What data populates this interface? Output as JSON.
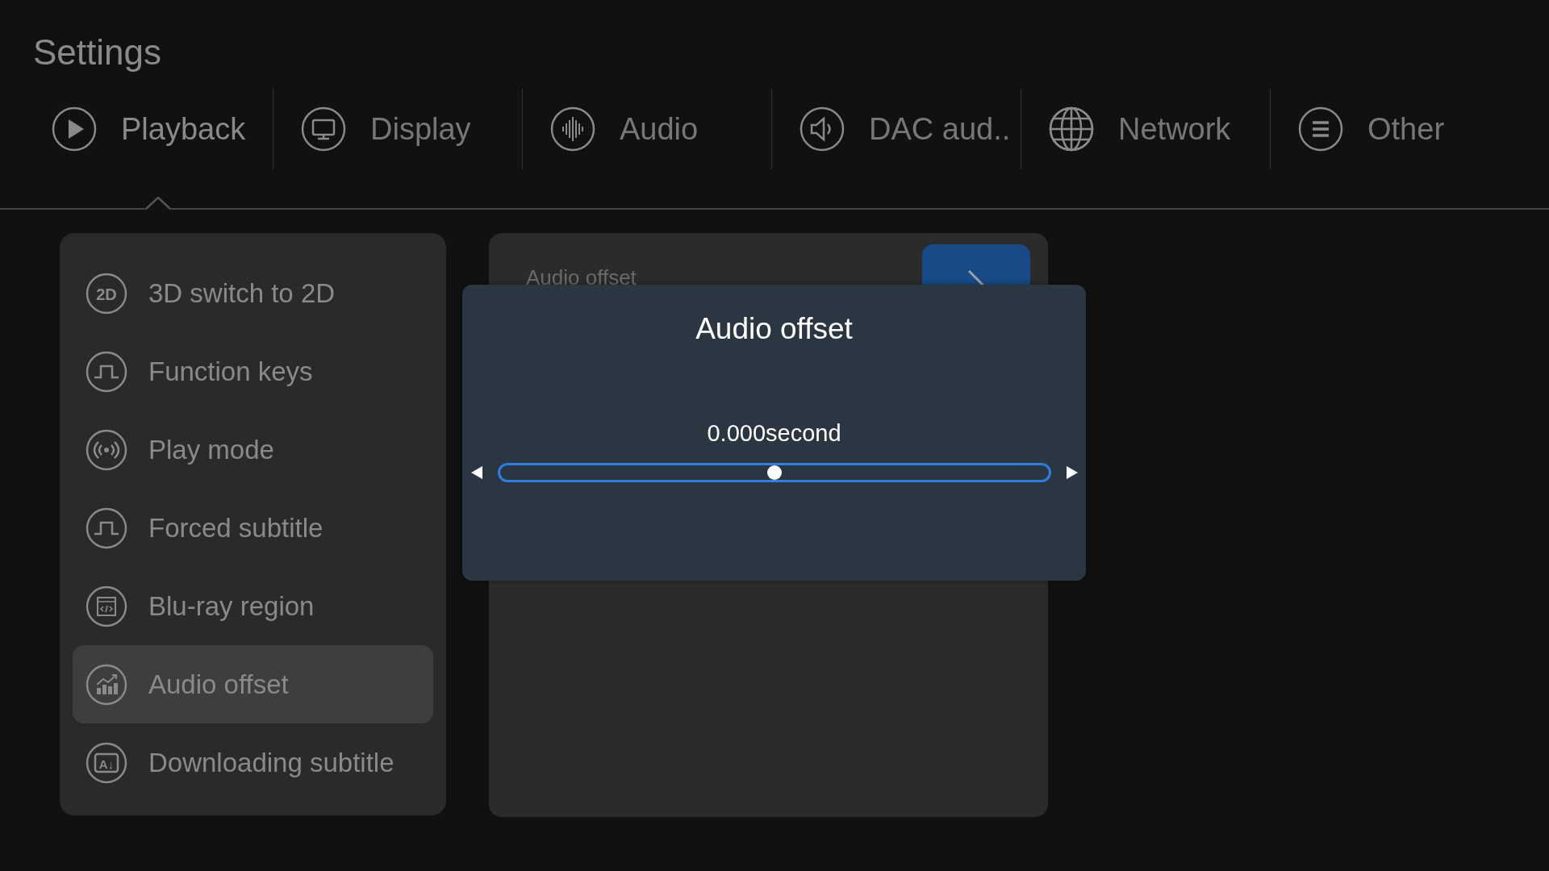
{
  "title": "Settings",
  "tabs": [
    {
      "label": "Playback",
      "selected": true
    },
    {
      "label": "Display",
      "selected": false
    },
    {
      "label": "Audio",
      "selected": false
    },
    {
      "label": "DAC aud..",
      "selected": false
    },
    {
      "label": "Network",
      "selected": false
    },
    {
      "label": "Other",
      "selected": false
    }
  ],
  "menu": [
    {
      "label": "3D switch to 2D",
      "icon_text": "2D",
      "selected": false
    },
    {
      "label": "Function keys",
      "selected": false
    },
    {
      "label": "Play mode",
      "selected": false
    },
    {
      "label": "Forced subtitle",
      "selected": false
    },
    {
      "label": "Blu-ray region",
      "selected": false
    },
    {
      "label": "Audio offset",
      "selected": true
    },
    {
      "label": "Downloading subtitle",
      "icon_text": "A↓",
      "selected": false
    }
  ],
  "panel": {
    "title": "Audio offset"
  },
  "dialog": {
    "title": "Audio offset",
    "value": "0.000second",
    "level": 0.5
  }
}
